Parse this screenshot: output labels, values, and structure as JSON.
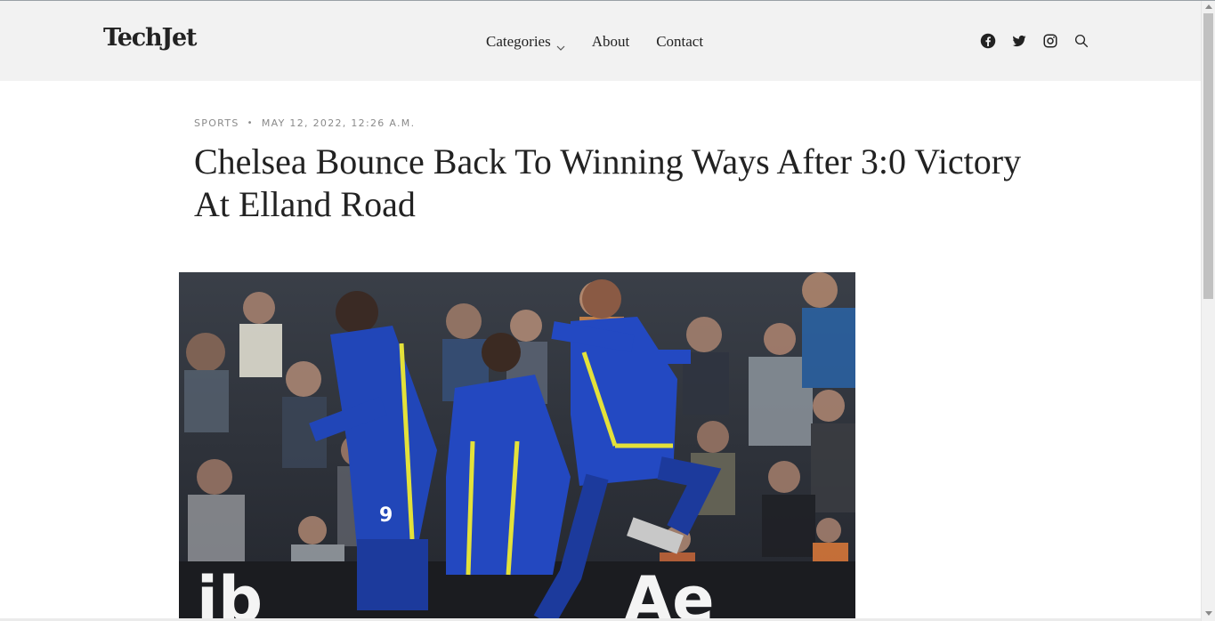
{
  "site": {
    "logo": "TechJet"
  },
  "nav": {
    "items": [
      {
        "label": "Categories",
        "has_dropdown": true
      },
      {
        "label": "About"
      },
      {
        "label": "Contact"
      }
    ]
  },
  "social": {
    "icons": [
      "facebook-icon",
      "twitter-icon",
      "instagram-icon",
      "search-icon"
    ]
  },
  "article": {
    "category": "SPORTS",
    "date": "MAY 12, 2022, 12:26 A.M.",
    "title": "Chelsea Bounce Back To Winning Ways After 3:0 Victory At Elland Road"
  },
  "colors": {
    "header_bg": "#f2f2f2",
    "text": "#222222",
    "meta_text": "#8a8a8a",
    "kit_blue": "#1f3fb0",
    "kit_yellow": "#e3e13a"
  }
}
